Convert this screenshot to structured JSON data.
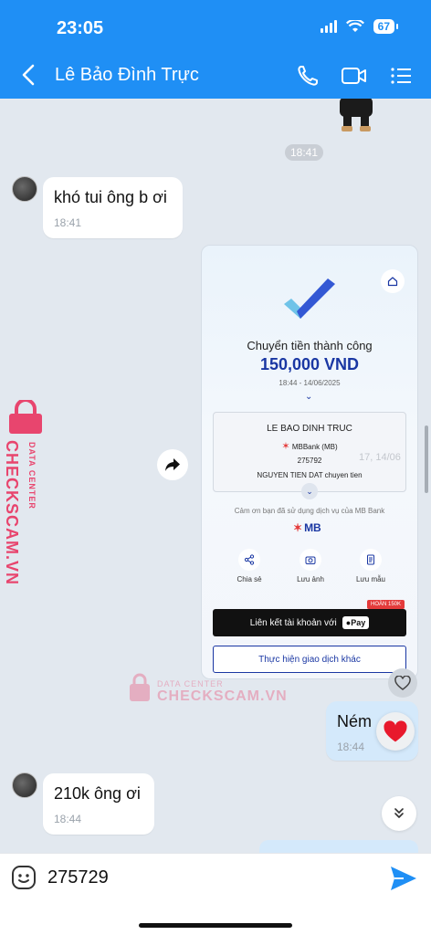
{
  "status": {
    "time": "23:05",
    "battery": "67"
  },
  "header": {
    "title": "Lê Bảo Đình Trực"
  },
  "messages": {
    "chip_time": "18:41",
    "m1": {
      "text": "khó tui ông b ơi",
      "time": "18:41"
    },
    "m2": {
      "text": "Ném",
      "time": "18:44"
    },
    "m3": {
      "text": "210k ông ơi",
      "time": "18:44"
    }
  },
  "receipt": {
    "title": "Chuyển tiền thành công",
    "amount": "150,000 VND",
    "datetime": "18:44 - 14/06/2025",
    "recipient": "LE BAO DINH TRUC",
    "bank": "MBBank (MB)",
    "account": "275792",
    "note": "NGUYEN TIEN DAT chuyen tien",
    "ghost": "17, 14/06",
    "thanks": "Cảm ơn bạn đã sử dụng dịch vụ của MB Bank",
    "logo": "MB",
    "actions": [
      "Chia sẻ",
      "Lưu ảnh",
      "Lưu mẫu"
    ],
    "link_label": "Liên kết tài khoản với",
    "pay_label": "Pay",
    "badge": "HOÀN 150K",
    "other_label": "Thực hiện giao dịch khác"
  },
  "watermark": {
    "big": "CHECKSCAM.VN",
    "small": "DATA CENTER"
  },
  "composer": {
    "value": "275729"
  },
  "colors": {
    "header": "#1f8ff5",
    "chat_bg": "#e2e8ef",
    "my_bubble": "#d4e9fb",
    "mb_blue": "#1a37a3",
    "watermark": "#e8456e"
  }
}
